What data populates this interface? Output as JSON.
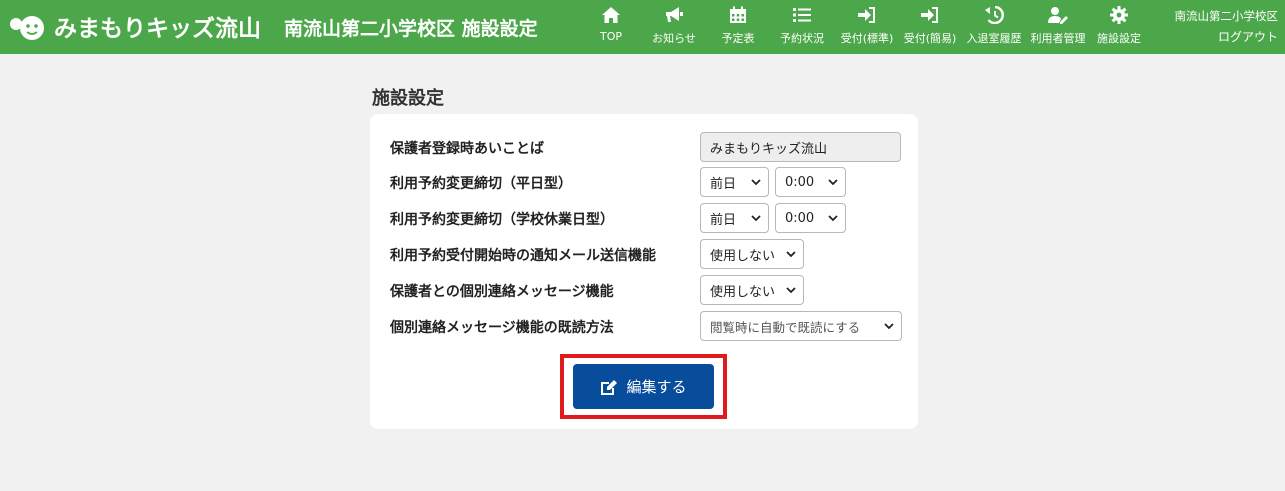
{
  "header": {
    "logo_text": "みまもりキッズ流山",
    "site_title": "南流山第二小学校区 施設設定",
    "user_name": "南流山第二小学校区",
    "logout_label": "ログアウト",
    "nav": [
      {
        "label": "TOP",
        "icon": "home-icon"
      },
      {
        "label": "お知らせ",
        "icon": "megaphone-icon"
      },
      {
        "label": "予定表",
        "icon": "calendar-icon"
      },
      {
        "label": "予約状況",
        "icon": "list-icon"
      },
      {
        "label": "受付(標準)",
        "icon": "sign-in-icon"
      },
      {
        "label": "受付(簡易)",
        "icon": "sign-in-icon"
      },
      {
        "label": "入退室履歴",
        "icon": "history-icon"
      },
      {
        "label": "利用者管理",
        "icon": "user-edit-icon"
      },
      {
        "label": "施設設定",
        "icon": "gear-icon"
      }
    ]
  },
  "page": {
    "title": "施設設定"
  },
  "settings": {
    "greeting": {
      "label": "保護者登録時あいことば",
      "value": "みまもりキッズ流山"
    },
    "deadline_weekday": {
      "label": "利用予約変更締切（平日型）",
      "day": "前日",
      "time": "0:00"
    },
    "deadline_holiday": {
      "label": "利用予約変更締切（学校休業日型）",
      "day": "前日",
      "time": "0:00"
    },
    "notify_mail": {
      "label": "利用予約受付開始時の通知メール送信機能",
      "value": "使用しない"
    },
    "message": {
      "label": "保護者との個別連絡メッセージ機能",
      "value": "使用しない"
    },
    "read_method": {
      "label": "個別連絡メッセージ機能の既読方法",
      "value": "閲覧時に自動で既読にする"
    }
  },
  "actions": {
    "edit_label": "編集する"
  },
  "colors": {
    "header_bg": "#4ca74a",
    "button_bg": "#084c9c",
    "highlight": "#e01a1a"
  }
}
